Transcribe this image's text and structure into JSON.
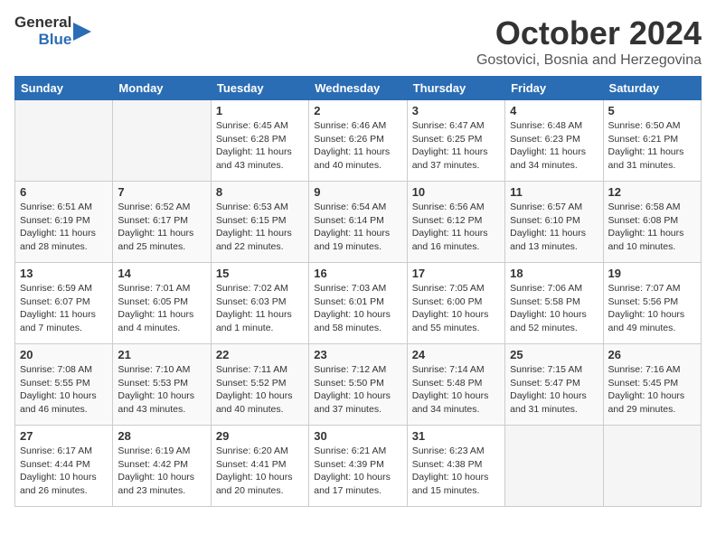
{
  "header": {
    "logo_general": "General",
    "logo_blue": "Blue",
    "month": "October 2024",
    "location": "Gostovici, Bosnia and Herzegovina"
  },
  "weekdays": [
    "Sunday",
    "Monday",
    "Tuesday",
    "Wednesday",
    "Thursday",
    "Friday",
    "Saturday"
  ],
  "weeks": [
    [
      {
        "day": "",
        "info": ""
      },
      {
        "day": "",
        "info": ""
      },
      {
        "day": "1",
        "info": "Sunrise: 6:45 AM\nSunset: 6:28 PM\nDaylight: 11 hours and 43 minutes."
      },
      {
        "day": "2",
        "info": "Sunrise: 6:46 AM\nSunset: 6:26 PM\nDaylight: 11 hours and 40 minutes."
      },
      {
        "day": "3",
        "info": "Sunrise: 6:47 AM\nSunset: 6:25 PM\nDaylight: 11 hours and 37 minutes."
      },
      {
        "day": "4",
        "info": "Sunrise: 6:48 AM\nSunset: 6:23 PM\nDaylight: 11 hours and 34 minutes."
      },
      {
        "day": "5",
        "info": "Sunrise: 6:50 AM\nSunset: 6:21 PM\nDaylight: 11 hours and 31 minutes."
      }
    ],
    [
      {
        "day": "6",
        "info": "Sunrise: 6:51 AM\nSunset: 6:19 PM\nDaylight: 11 hours and 28 minutes."
      },
      {
        "day": "7",
        "info": "Sunrise: 6:52 AM\nSunset: 6:17 PM\nDaylight: 11 hours and 25 minutes."
      },
      {
        "day": "8",
        "info": "Sunrise: 6:53 AM\nSunset: 6:15 PM\nDaylight: 11 hours and 22 minutes."
      },
      {
        "day": "9",
        "info": "Sunrise: 6:54 AM\nSunset: 6:14 PM\nDaylight: 11 hours and 19 minutes."
      },
      {
        "day": "10",
        "info": "Sunrise: 6:56 AM\nSunset: 6:12 PM\nDaylight: 11 hours and 16 minutes."
      },
      {
        "day": "11",
        "info": "Sunrise: 6:57 AM\nSunset: 6:10 PM\nDaylight: 11 hours and 13 minutes."
      },
      {
        "day": "12",
        "info": "Sunrise: 6:58 AM\nSunset: 6:08 PM\nDaylight: 11 hours and 10 minutes."
      }
    ],
    [
      {
        "day": "13",
        "info": "Sunrise: 6:59 AM\nSunset: 6:07 PM\nDaylight: 11 hours and 7 minutes."
      },
      {
        "day": "14",
        "info": "Sunrise: 7:01 AM\nSunset: 6:05 PM\nDaylight: 11 hours and 4 minutes."
      },
      {
        "day": "15",
        "info": "Sunrise: 7:02 AM\nSunset: 6:03 PM\nDaylight: 11 hours and 1 minute."
      },
      {
        "day": "16",
        "info": "Sunrise: 7:03 AM\nSunset: 6:01 PM\nDaylight: 10 hours and 58 minutes."
      },
      {
        "day": "17",
        "info": "Sunrise: 7:05 AM\nSunset: 6:00 PM\nDaylight: 10 hours and 55 minutes."
      },
      {
        "day": "18",
        "info": "Sunrise: 7:06 AM\nSunset: 5:58 PM\nDaylight: 10 hours and 52 minutes."
      },
      {
        "day": "19",
        "info": "Sunrise: 7:07 AM\nSunset: 5:56 PM\nDaylight: 10 hours and 49 minutes."
      }
    ],
    [
      {
        "day": "20",
        "info": "Sunrise: 7:08 AM\nSunset: 5:55 PM\nDaylight: 10 hours and 46 minutes."
      },
      {
        "day": "21",
        "info": "Sunrise: 7:10 AM\nSunset: 5:53 PM\nDaylight: 10 hours and 43 minutes."
      },
      {
        "day": "22",
        "info": "Sunrise: 7:11 AM\nSunset: 5:52 PM\nDaylight: 10 hours and 40 minutes."
      },
      {
        "day": "23",
        "info": "Sunrise: 7:12 AM\nSunset: 5:50 PM\nDaylight: 10 hours and 37 minutes."
      },
      {
        "day": "24",
        "info": "Sunrise: 7:14 AM\nSunset: 5:48 PM\nDaylight: 10 hours and 34 minutes."
      },
      {
        "day": "25",
        "info": "Sunrise: 7:15 AM\nSunset: 5:47 PM\nDaylight: 10 hours and 31 minutes."
      },
      {
        "day": "26",
        "info": "Sunrise: 7:16 AM\nSunset: 5:45 PM\nDaylight: 10 hours and 29 minutes."
      }
    ],
    [
      {
        "day": "27",
        "info": "Sunrise: 6:17 AM\nSunset: 4:44 PM\nDaylight: 10 hours and 26 minutes."
      },
      {
        "day": "28",
        "info": "Sunrise: 6:19 AM\nSunset: 4:42 PM\nDaylight: 10 hours and 23 minutes."
      },
      {
        "day": "29",
        "info": "Sunrise: 6:20 AM\nSunset: 4:41 PM\nDaylight: 10 hours and 20 minutes."
      },
      {
        "day": "30",
        "info": "Sunrise: 6:21 AM\nSunset: 4:39 PM\nDaylight: 10 hours and 17 minutes."
      },
      {
        "day": "31",
        "info": "Sunrise: 6:23 AM\nSunset: 4:38 PM\nDaylight: 10 hours and 15 minutes."
      },
      {
        "day": "",
        "info": ""
      },
      {
        "day": "",
        "info": ""
      }
    ]
  ]
}
